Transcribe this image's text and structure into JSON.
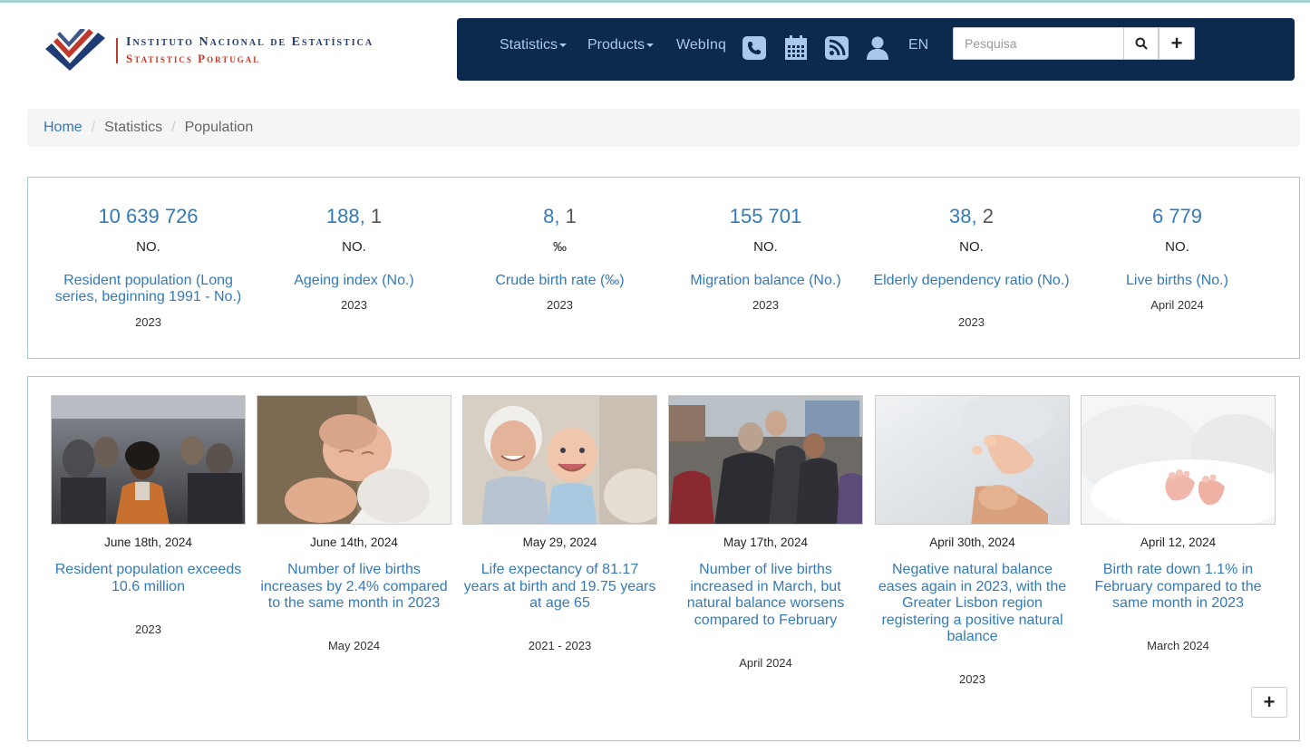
{
  "logo": {
    "line1": "Instituto Nacional de Estatística",
    "line2": "Statistics Portugal",
    "colors": {
      "blue": "#1f3b73",
      "red": "#c0392b"
    }
  },
  "navbar": {
    "background": "#0c2a4d",
    "items": [
      {
        "label": "Statistics",
        "icon": "caret-down-icon"
      },
      {
        "label": "Products",
        "icon": "caret-down-icon"
      },
      {
        "label": "WebInq"
      }
    ],
    "icons": [
      "phone-icon",
      "calendar-icon",
      "rss-icon",
      "user-icon"
    ],
    "language": "EN",
    "search": {
      "placeholder": "Pesquisa",
      "value": ""
    },
    "search_icon": "search-icon",
    "plus_label": "+"
  },
  "breadcrumb": {
    "home": "Home",
    "sep": "/",
    "level1": "Statistics",
    "current": "Population"
  },
  "indicators": [
    {
      "value": "10 639 726",
      "unit": "NO.",
      "name": "Resident population (Long series, beginning 1991 - No.)",
      "period": "2023"
    },
    {
      "value_int": "188,",
      "value_dec": " 1",
      "unit": "NO.",
      "name": "Ageing index (No.)",
      "period": "2023"
    },
    {
      "value_int": "8,",
      "value_dec": " 1",
      "unit": "‰",
      "name": "Crude birth rate (‰)",
      "period": "2023"
    },
    {
      "value": "155 701",
      "unit": "NO.",
      "name": "Migration balance (No.)",
      "period": "2023"
    },
    {
      "value_int": "38,",
      "value_dec": " 2",
      "unit": "NO.",
      "name": "Elderly dependency ratio (No.)",
      "period": "2023"
    },
    {
      "value": "6 779",
      "unit": "NO.",
      "name": "Live births (No.)",
      "period": "April 2024"
    }
  ],
  "news": [
    {
      "date": "June 18th, 2024",
      "title": "Resident population exceeds 10.6 million",
      "period": "2023"
    },
    {
      "date": "June 14th, 2024",
      "title": "Number of live births increases by 2.4% compared to the same month in 2023",
      "period": "May 2024"
    },
    {
      "date": "May 29, 2024",
      "title": "Life expectancy of 81.17 years at birth and 19.75 years at age 65",
      "period": "2021 - 2023"
    },
    {
      "date": "May 17th, 2024",
      "title": "Number of live births increased in March, but natural balance worsens compared to February",
      "period": "April 2024"
    },
    {
      "date": "April 30th, 2024",
      "title": "Negative natural balance eases again in 2023, with the Greater Lisbon region registering a positive natural balance",
      "period": "2023"
    },
    {
      "date": "April 12, 2024",
      "title": "Birth rate down 1.1% in February compared to the same month in 2023",
      "period": "March 2024"
    }
  ],
  "more_label": "+",
  "colors": {
    "link": "#337ab7",
    "panel_border": "#a8c8c8",
    "breadcrumb_bg": "#f5f5f5"
  }
}
